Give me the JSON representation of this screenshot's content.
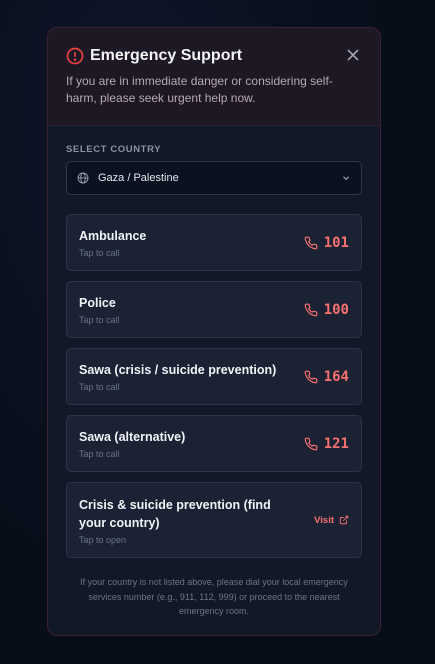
{
  "modal": {
    "title": "Emergency Support",
    "subtitle": "If you are in immediate danger or considering self-harm, please seek urgent help now.",
    "close_icon": "close-icon",
    "alert_icon": "alert-circle-icon"
  },
  "country": {
    "label": "SELECT COUNTRY",
    "selected": "Gaza / Palestine"
  },
  "services": [
    {
      "name": "Ambulance",
      "hint": "Tap to call",
      "number": "101"
    },
    {
      "name": "Police",
      "hint": "Tap to call",
      "number": "100"
    },
    {
      "name": "Sawa (crisis / suicide prevention)",
      "hint": "Tap to call",
      "number": "164"
    },
    {
      "name": "Sawa (alternative)",
      "hint": "Tap to call",
      "number": "121"
    }
  ],
  "external": {
    "name": "Crisis & suicide prevention (find your country)",
    "hint": "Tap to open",
    "action": "Visit"
  },
  "footer": "If your country is not listed above, please dial your local emergency services number (e.g., 911, 112, 999) or proceed to the nearest emergency room.",
  "colors": {
    "accent": "#f87171",
    "background": "#111827",
    "card": "#1a2234"
  }
}
